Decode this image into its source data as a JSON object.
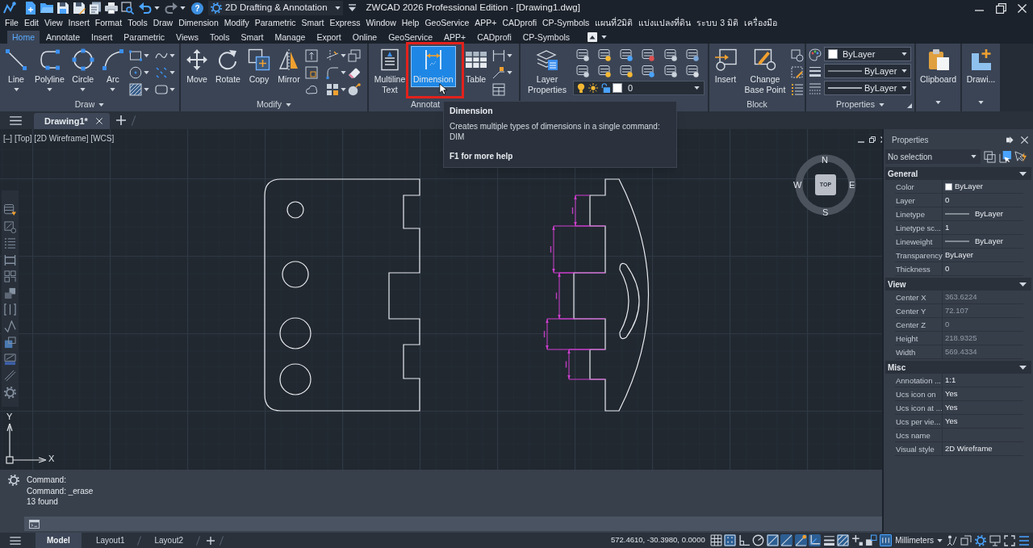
{
  "title_bar": {
    "workspace": "2D Drafting & Annotation",
    "help": "?",
    "title": "ZWCAD 2026 Professional Edition - [Drawing1.dwg]"
  },
  "menu_bar": [
    "File",
    "Edit",
    "View",
    "Insert",
    "Format",
    "Tools",
    "Draw",
    "Dimension",
    "Modify",
    "Parametric",
    "Smart",
    "Express",
    "Window",
    "Help",
    "GeoService",
    "APP+",
    "CADprofi",
    "CP-Symbols",
    "แผนที่2มิติ",
    "แบ่งแปลงที่ดิน",
    "ระบบ 3 มิติ",
    "เครื่องมือ"
  ],
  "ribbon": {
    "tabs": [
      {
        "label": "Home",
        "selected": true
      },
      {
        "label": "Annotate",
        "selected": false
      },
      {
        "label": "Insert",
        "selected": false
      },
      {
        "label": "Parametric",
        "selected": false
      },
      {
        "label": "Views",
        "selected": false
      },
      {
        "label": "Tools",
        "selected": false
      },
      {
        "label": "Smart",
        "selected": false
      },
      {
        "label": "Manage",
        "selected": false
      },
      {
        "label": "Export",
        "selected": false
      },
      {
        "label": "Online",
        "selected": false
      },
      {
        "label": "GeoService",
        "selected": false
      },
      {
        "label": "APP+",
        "selected": false
      },
      {
        "label": "CADprofi",
        "selected": false
      },
      {
        "label": "CP-Symbols",
        "selected": false
      }
    ],
    "hover_frame": true,
    "panels": [
      {
        "kind": "tools",
        "title": "Draw",
        "expandable": true,
        "tools": [
          {
            "label": "Line",
            "menu": true,
            "hovered": false
          },
          {
            "label": "Polyline",
            "menu": true,
            "hovered": false
          },
          {
            "label": "Circle",
            "menu": true,
            "hovered": false
          },
          {
            "label": "Arc",
            "menu": true,
            "hovered": false
          }
        ]
      },
      {
        "kind": "tools",
        "title": "Modify",
        "expandable": true,
        "tools": [
          {
            "label": "Move",
            "menu": false,
            "hovered": false
          },
          {
            "label": "Rotate",
            "menu": false,
            "hovered": false
          },
          {
            "label": "Copy",
            "menu": false,
            "hovered": false
          },
          {
            "label": "Mirror",
            "menu": false,
            "hovered": false
          }
        ]
      },
      {
        "kind": "tools",
        "title": "Annotat",
        "expandable": false,
        "tools": [
          {
            "label": "Multiline Text",
            "menu": false,
            "hovered": false
          },
          {
            "label": "Dimension",
            "menu": false,
            "hovered": true
          },
          {
            "label": "Table",
            "menu": false,
            "hovered": false
          }
        ]
      },
      {
        "kind": "layers",
        "tools": [
          {
            "label": "Layer Properties",
            "menu": false,
            "hovered": false
          }
        ],
        "current_layer": "0"
      },
      {
        "kind": "tools",
        "title": "Block",
        "expandable": false,
        "tools": [
          {
            "label": "Insert",
            "menu": false,
            "hovered": false
          },
          {
            "label": "Change Base Point",
            "menu": false,
            "hovered": false
          }
        ]
      },
      {
        "kind": "properties",
        "title": "Properties",
        "expandable": true,
        "dropdowns": [
          {
            "kind": "color",
            "value": "ByLayer"
          },
          {
            "kind": "linetype",
            "value": "ByLayer"
          },
          {
            "kind": "lineweight",
            "value": "ByLayer"
          }
        ]
      },
      {
        "kind": "tools",
        "tools": [
          {
            "label": "Clipboard",
            "menu": true,
            "hovered": false
          }
        ]
      },
      {
        "kind": "tools",
        "tools": [
          {
            "label": "Drawi...",
            "menu": true,
            "hovered": false
          }
        ]
      }
    ]
  },
  "tooltip": {
    "title": "Dimension",
    "description": "Creates multiple types of dimensions in a single command: DIM",
    "help": "F1 for more help"
  },
  "document_tabs": [
    {
      "label": "Drawing1*",
      "selected": true
    }
  ],
  "viewport": {
    "label": "[–] [Top] [2D Wireframe] [WCS]",
    "view_cube": {
      "top": "TOP",
      "north": "N",
      "east": "E",
      "south": "S",
      "west": "W"
    },
    "ucs": {
      "x": "X",
      "y": "Y"
    }
  },
  "properties_palette": {
    "title": "Properties",
    "selection": "No selection",
    "sections": [
      {
        "title": "General",
        "expanded": true,
        "rows": [
          {
            "label": "Color",
            "kind": "swatch",
            "value": "ByLayer",
            "disabled": false
          },
          {
            "label": "Layer",
            "kind": "text",
            "value": "0",
            "disabled": false
          },
          {
            "label": "Linetype",
            "kind": "line",
            "value": "ByLayer",
            "disabled": false
          },
          {
            "label": "Linetype sc...",
            "kind": "text",
            "value": "1",
            "disabled": false
          },
          {
            "label": "Lineweight",
            "kind": "line",
            "value": "ByLayer",
            "disabled": false
          },
          {
            "label": "Transparency",
            "kind": "text",
            "value": "ByLayer",
            "disabled": false
          },
          {
            "label": "Thickness",
            "kind": "text",
            "value": "0",
            "disabled": false
          }
        ]
      },
      {
        "title": "View",
        "expanded": true,
        "rows": [
          {
            "label": "Center X",
            "kind": "text",
            "value": "363.6224",
            "disabled": true
          },
          {
            "label": "Center Y",
            "kind": "text",
            "value": "72.107",
            "disabled": true
          },
          {
            "label": "Center Z",
            "kind": "text",
            "value": "0",
            "disabled": true
          },
          {
            "label": "Height",
            "kind": "text",
            "value": "218.9325",
            "disabled": true
          },
          {
            "label": "Width",
            "kind": "text",
            "value": "569.4334",
            "disabled": true
          }
        ]
      },
      {
        "title": "Misc",
        "expanded": true,
        "rows": [
          {
            "label": "Annotation ...",
            "kind": "text",
            "value": "1:1",
            "disabled": false
          },
          {
            "label": "Ucs icon on",
            "kind": "text",
            "value": "Yes",
            "disabled": false
          },
          {
            "label": "Ucs icon at ...",
            "kind": "text",
            "value": "Yes",
            "disabled": false
          },
          {
            "label": "Ucs per vie...",
            "kind": "text",
            "value": "Yes",
            "disabled": false
          },
          {
            "label": "Ucs name",
            "kind": "text"
          },
          {
            "label": "Visual style",
            "kind": "text",
            "value": "2D Wireframe",
            "disabled": false
          }
        ]
      }
    ]
  },
  "command_line": {
    "history": [
      "Command:",
      "Command: _erase",
      "13 found"
    ]
  },
  "status_bar": {
    "layouts": [
      {
        "label": "Model",
        "selected": true
      },
      {
        "label": "Layout1",
        "selected": false
      },
      {
        "label": "Layout2",
        "selected": false
      }
    ],
    "coordinates": "572.4610, -30.3980, 0.0000",
    "toggles": [
      {
        "on": false
      },
      {
        "on": true
      },
      {
        "on": false
      },
      {
        "on": false
      },
      {
        "on": true
      },
      {
        "on": true
      },
      {
        "on": true
      },
      {
        "on": true
      },
      {
        "on": false
      },
      {
        "on": true
      },
      {
        "on": false
      },
      {
        "on": false
      },
      {
        "on": true
      }
    ],
    "units": "Millimeters"
  }
}
